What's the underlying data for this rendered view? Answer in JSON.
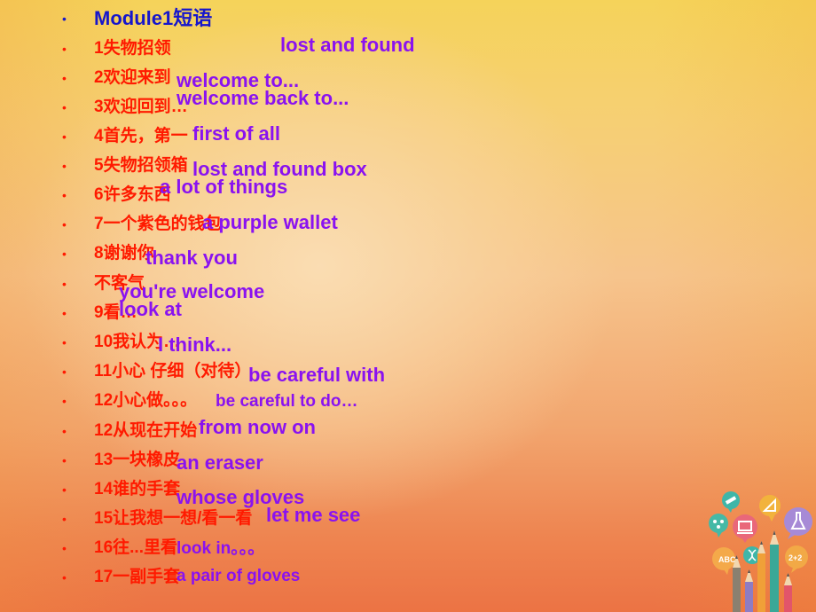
{
  "slide": {
    "title": "Module1短语",
    "items": [
      {
        "zh": "1失物招领",
        "en": "lost and found"
      },
      {
        "zh": "2欢迎来到",
        "en": "welcome to..."
      },
      {
        "zh": "3欢迎回到…",
        "en": "welcome back to..."
      },
      {
        "zh": "4首先，第一",
        "en": "first of all"
      },
      {
        "zh": "5失物招领箱",
        "en": "lost and found box"
      },
      {
        "zh": "6许多东西",
        "en": "a lot of things"
      },
      {
        "zh": "7一个紫色的钱包",
        "en": "a purple wallet"
      },
      {
        "zh": "8谢谢你",
        "en": "thank you"
      },
      {
        "zh": "不客气",
        "en": "you're welcome"
      },
      {
        "zh": "9看…",
        "en": "look at"
      },
      {
        "zh": "10我认为…",
        "en": "I think..."
      },
      {
        "zh": "11小心 仔细（对待）",
        "en": "be careful with"
      },
      {
        "zh": "12小心做。。。",
        "en": "be careful to do…"
      },
      {
        "zh": "12从现在开始",
        "en": "from now on"
      },
      {
        "zh": "13一块橡皮",
        "en": "an eraser"
      },
      {
        "zh": "14谁的手套",
        "en": "whose gloves"
      },
      {
        "zh": "15让我想一想/看一看",
        "en": "let me see"
      },
      {
        "zh": "16往...里看",
        "en": "look in。。。"
      },
      {
        "zh": "17一副手套",
        "en": "a pair of gloves"
      }
    ],
    "bullet": "•",
    "decoration": "education-pencils-illustration",
    "colors": {
      "title": "#1616cc",
      "chinese": "#ff1a00",
      "english": "#8a12f0",
      "bg_top": "#f5d35a",
      "bg_center": "#f9d8a8",
      "bg_bottom": "#ec7344"
    }
  }
}
